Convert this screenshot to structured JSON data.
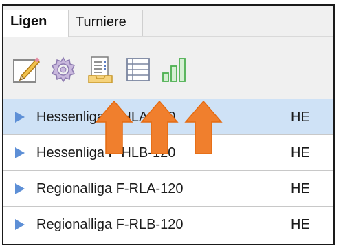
{
  "tabs": [
    {
      "label": "Ligen",
      "active": true
    },
    {
      "label": "Turniere",
      "active": false
    }
  ],
  "toolbar": {
    "icons": [
      "pencil-icon",
      "gear-icon",
      "report-icon",
      "list-icon",
      "bar-chart-icon"
    ]
  },
  "rows": [
    {
      "name": "Hessenliga F-HLA-120",
      "code": "HE",
      "selected": true
    },
    {
      "name": "Hessenliga F-HLB-120",
      "code": "HE",
      "selected": false
    },
    {
      "name": "Regionalliga F-RLA-120",
      "code": "HE",
      "selected": false
    },
    {
      "name": "Regionalliga F-RLB-120",
      "code": "HE",
      "selected": false
    }
  ],
  "colors": {
    "selection": "#cfe2f6",
    "arrow": "#f07f2d",
    "triangle": "#5d8fd6",
    "chart_green": "#4caf50"
  }
}
